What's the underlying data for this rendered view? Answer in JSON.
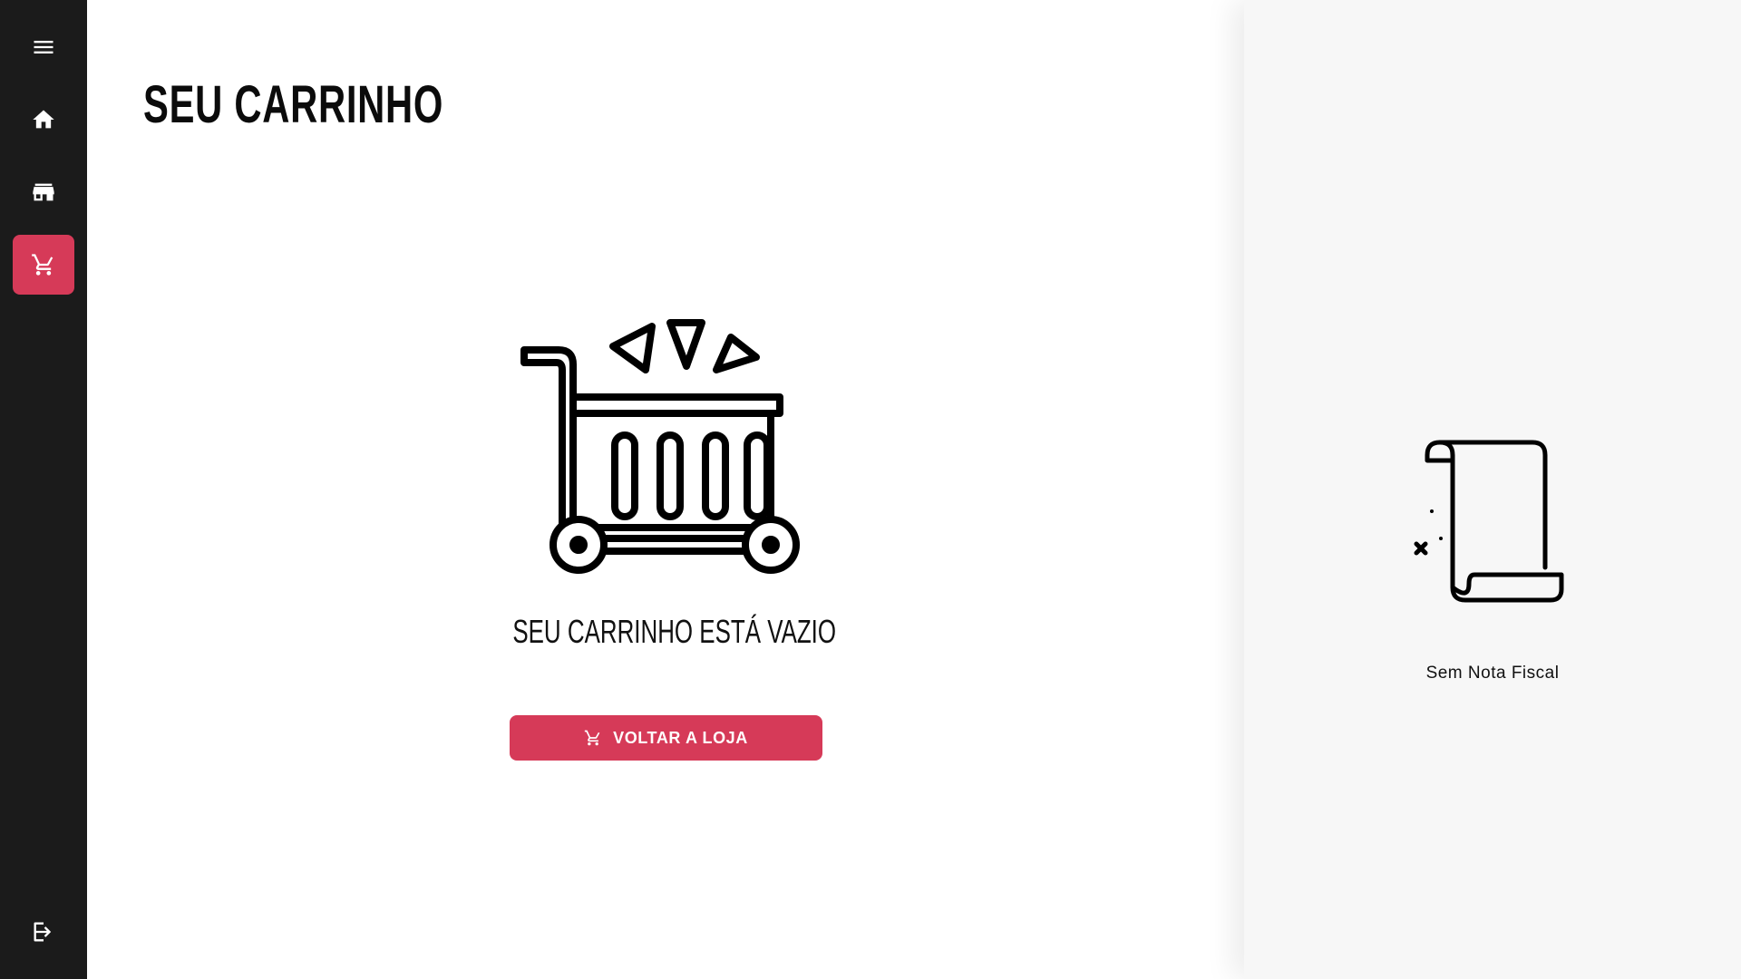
{
  "sidebar": {
    "items": [
      {
        "icon": "menu-icon"
      },
      {
        "icon": "home-icon"
      },
      {
        "icon": "store-icon"
      },
      {
        "icon": "cart-icon",
        "active": true
      }
    ],
    "bottom": {
      "icon": "logout-icon"
    },
    "background": "#1b1b1b",
    "active_color": "#d63a58"
  },
  "main": {
    "title": "SEU CARRINHO",
    "empty_message": "SEU CARRINHO ESTÁ VAZIO",
    "back_button_label": "VOLTAR A LOJA",
    "back_button_icon": "cart-icon",
    "illustration": "empty-cart-illustration"
  },
  "receipt_panel": {
    "illustration": "no-receipt-scroll-illustration",
    "message": "Sem Nota Fiscal",
    "background": "#f7f7f7"
  },
  "colors": {
    "accent": "#d63a58",
    "text": "#0b0b0b"
  }
}
